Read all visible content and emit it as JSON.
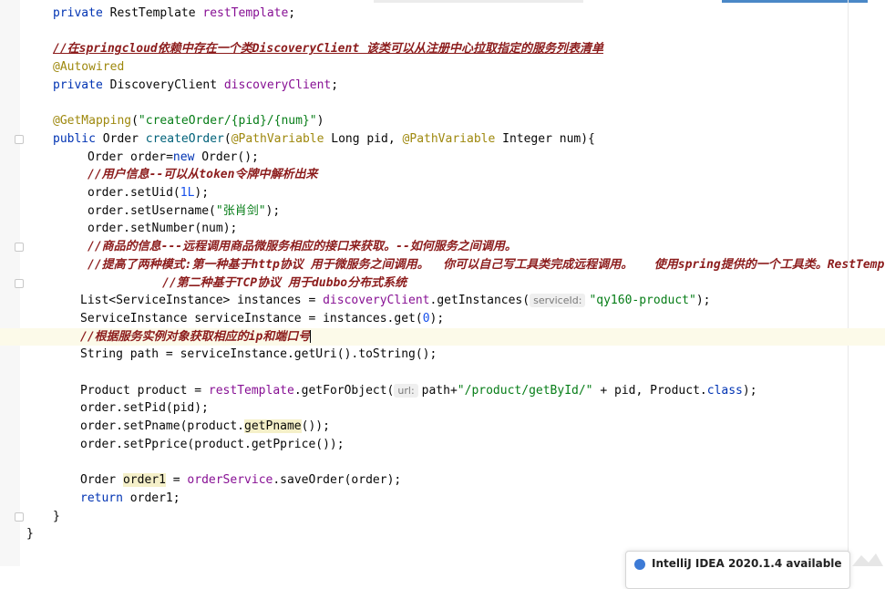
{
  "editor": {
    "lines": [
      {
        "t": [
          [
            "kw",
            "private "
          ],
          [
            "p",
            "RestTemplate "
          ],
          [
            "fld",
            "restTemplate"
          ],
          [
            "p",
            ";"
          ]
        ],
        "indent": 58
      },
      {
        "t": [],
        "indent": 58
      },
      {
        "t": [
          [
            "cmtu",
            "//在springcloud依赖中存在一个类DiscoveryClient 该类可以从注册中心拉取指定的服务列表清单"
          ]
        ],
        "indent": 58
      },
      {
        "t": [
          [
            "ann",
            "@Autowired"
          ]
        ],
        "indent": 58
      },
      {
        "t": [
          [
            "kw",
            "private "
          ],
          [
            "p",
            "DiscoveryClient "
          ],
          [
            "fld",
            "discoveryClient"
          ],
          [
            "p",
            ";"
          ]
        ],
        "indent": 58
      },
      {
        "t": [],
        "indent": 58
      },
      {
        "t": [
          [
            "ann",
            "@GetMapping"
          ],
          [
            "p",
            "("
          ],
          [
            "str",
            "\"createOrder/{pid}/{num}\""
          ],
          [
            "p",
            ")"
          ]
        ],
        "indent": 58
      },
      {
        "t": [
          [
            "kw",
            "public "
          ],
          [
            "p",
            "Order "
          ],
          [
            "mth",
            "createOrder"
          ],
          [
            "p",
            "("
          ],
          [
            "ann",
            "@PathVariable "
          ],
          [
            "p",
            "Long pid, "
          ],
          [
            "ann",
            "@PathVariable "
          ],
          [
            "p",
            "Integer num){"
          ]
        ],
        "indent": 58,
        "fold": true
      },
      {
        "t": [
          [
            "p",
            "Order order="
          ],
          [
            "kw",
            "new "
          ],
          [
            "p",
            "Order();"
          ]
        ],
        "indent": 96
      },
      {
        "t": [
          [
            "cmt",
            "//用户信息--可以从token令牌中解析出来"
          ]
        ],
        "indent": 96
      },
      {
        "t": [
          [
            "p",
            "order.setUid("
          ],
          [
            "num",
            "1L"
          ],
          [
            "p",
            ");"
          ]
        ],
        "indent": 96
      },
      {
        "t": [
          [
            "p",
            "order.setUsername("
          ],
          [
            "str",
            "\"张肖剑\""
          ],
          [
            "p",
            ");"
          ]
        ],
        "indent": 96
      },
      {
        "t": [
          [
            "p",
            "order.setNumber(num);"
          ]
        ],
        "indent": 96
      },
      {
        "t": [
          [
            "cmt",
            "//商品的信息---远程调用商品微服务相应的接口来获取。--如何服务之间调用。"
          ]
        ],
        "indent": 96,
        "fold": true
      },
      {
        "t": [
          [
            "cmt",
            "//提高了两种模式:第一种基于http协议 用于微服务之间调用。  你可以自己写工具类完成远程调用。   使用spring提供的一个工具类。RestTemplate"
          ]
        ],
        "indent": 96
      },
      {
        "t": [
          [
            "cmt",
            "//第二种基于TCP协议 用于dubbo分布式系统"
          ]
        ],
        "indent": 178,
        "fold": true
      },
      {
        "t": [
          [
            "p",
            "List<ServiceInstance> instances = "
          ],
          [
            "fld",
            "discoveryClient"
          ],
          [
            "p",
            ".getInstances("
          ],
          [
            "hint",
            "serviceId:"
          ],
          [
            "str",
            "\"qy160-product\""
          ],
          [
            "p",
            ");"
          ]
        ],
        "indent": 88
      },
      {
        "t": [
          [
            "p",
            "ServiceInstance serviceInstance = instances.get("
          ],
          [
            "num",
            "0"
          ],
          [
            "p",
            ");"
          ]
        ],
        "indent": 88
      },
      {
        "t": [
          [
            "cmt",
            "//根据服务实例对象获取相应的ip和端口号"
          ],
          [
            "caret",
            ""
          ]
        ],
        "indent": 88,
        "current": true
      },
      {
        "t": [
          [
            "p",
            "String path = serviceInstance.getUri().toString();"
          ]
        ],
        "indent": 88
      },
      {
        "t": [],
        "indent": 88
      },
      {
        "t": [
          [
            "p",
            "Product product = "
          ],
          [
            "fld",
            "restTemplate"
          ],
          [
            "p",
            ".getForObject("
          ],
          [
            "hint",
            "url:"
          ],
          [
            "p",
            "path+"
          ],
          [
            "str",
            "\"/product/getById/\""
          ],
          [
            "p",
            " + pid, Product."
          ],
          [
            "kw",
            "class"
          ],
          [
            "p",
            ");"
          ]
        ],
        "indent": 88
      },
      {
        "t": [
          [
            "p",
            "order.setPid(pid);"
          ]
        ],
        "indent": 88
      },
      {
        "t": [
          [
            "p",
            "order.setPname(product."
          ],
          [
            "hl",
            "getPname"
          ],
          [
            "p",
            "());"
          ]
        ],
        "indent": 88
      },
      {
        "t": [
          [
            "p",
            "order.setPprice(product.getPprice());"
          ]
        ],
        "indent": 88
      },
      {
        "t": [],
        "indent": 88
      },
      {
        "t": [
          [
            "p",
            "Order "
          ],
          [
            "hl",
            "order1"
          ],
          [
            "p",
            " = "
          ],
          [
            "fld",
            "orderService"
          ],
          [
            "p",
            ".saveOrder(order);"
          ]
        ],
        "indent": 88
      },
      {
        "t": [
          [
            "kw",
            "return "
          ],
          [
            "p",
            "order1;"
          ]
        ],
        "indent": 88
      },
      {
        "t": [
          [
            "p",
            "}"
          ]
        ],
        "indent": 58,
        "fold": true
      },
      {
        "t": [
          [
            "p",
            "}"
          ]
        ],
        "indent": 29
      }
    ]
  },
  "notification": {
    "text": "IntelliJ IDEA 2020.1.4 available"
  },
  "colors": {
    "keyword": "#0033b3",
    "field": "#871094",
    "annotation": "#9e880d",
    "string": "#067d17",
    "number": "#1750eb",
    "comment": "#8c1c1c"
  }
}
